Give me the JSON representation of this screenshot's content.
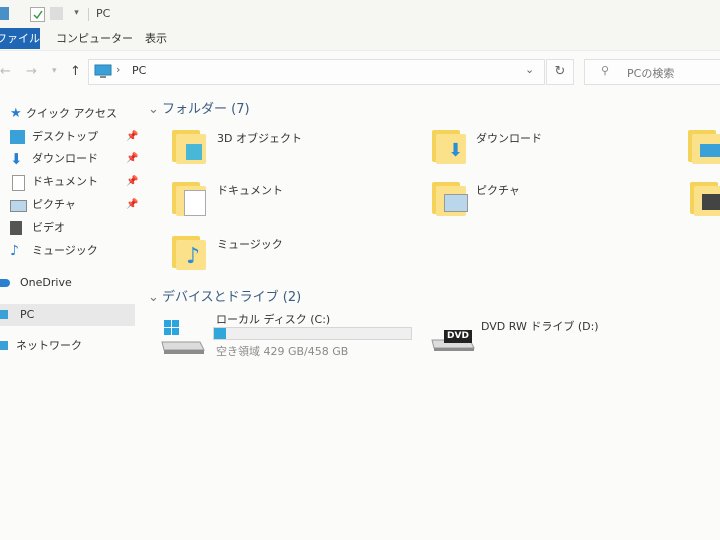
{
  "window": {
    "title": "PC"
  },
  "ribbon": {
    "tabs": [
      "ファイル",
      "コンピューター",
      "表示"
    ]
  },
  "address": {
    "path_item": "PC",
    "search_placeholder": "PCの検索"
  },
  "sidebar": {
    "quick_access": "クイック アクセス",
    "items": [
      {
        "label": "デスクトップ",
        "icon": "desktop-icon",
        "pinned": true
      },
      {
        "label": "ダウンロード",
        "icon": "download-icon",
        "pinned": true
      },
      {
        "label": "ドキュメント",
        "icon": "document-icon",
        "pinned": true
      },
      {
        "label": "ピクチャ",
        "icon": "pictures-icon",
        "pinned": true
      },
      {
        "label": "ビデオ",
        "icon": "video-icon",
        "pinned": false
      },
      {
        "label": "ミュージック",
        "icon": "music-icon",
        "pinned": false
      }
    ],
    "onedrive": "OneDrive",
    "pc": "PC",
    "network": "ネットワーク"
  },
  "folders_group": {
    "header": "フォルダー (7)",
    "items": [
      "3D オブジェクト",
      "ダウンロード",
      "ドキュメント",
      "ピクチャ",
      "ミュージック"
    ]
  },
  "drives_group": {
    "header": "デバイスとドライブ (2)",
    "local_disk": {
      "name": "ローカル ディスク (C:)",
      "free": "空き領域 429 GB/458 GB",
      "used_fraction": 0.063
    },
    "dvd": {
      "name": "DVD RW ドライブ (D:)",
      "badge": "DVD"
    }
  },
  "colors": {
    "accent": "#1f66b5",
    "folder": "#f5d35a",
    "drive_bar": "#2fa7d8"
  }
}
